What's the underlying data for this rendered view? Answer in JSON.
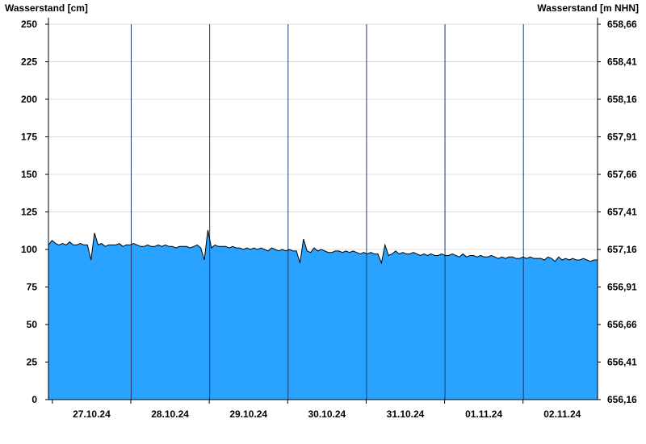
{
  "chart_data": {
    "type": "area",
    "ylabel_left": "Wasserstand [cm]",
    "ylabel_right": "Wasserstand [m NHN]",
    "ylim": [
      0,
      255
    ],
    "yticks_left": [
      "0",
      "25",
      "50",
      "75",
      "100",
      "125",
      "150",
      "175",
      "200",
      "225",
      "250"
    ],
    "yticks_right": [
      "656,16",
      "656,41",
      "656,66",
      "656,91",
      "657,16",
      "657,41",
      "657,66",
      "657,91",
      "658,16",
      "658,41",
      "658,66"
    ],
    "x_labels": [
      "27.10.24",
      "28.10.24",
      "29.10.24",
      "30.10.24",
      "31.10.24",
      "01.11.24",
      "02.11.24"
    ],
    "grid": true,
    "fill_color": "#29a3ff",
    "line_color": "#000000",
    "series": [
      {
        "values": [
          103,
          106,
          104,
          103,
          104,
          103,
          105,
          103,
          103,
          104,
          103,
          103,
          93,
          111,
          103,
          104,
          102,
          103,
          103,
          103,
          104,
          102,
          103,
          103,
          104,
          103,
          102,
          102,
          103,
          102,
          102,
          103,
          102,
          103,
          102,
          102,
          101,
          102,
          102,
          102,
          101,
          102,
          103,
          101,
          93,
          113,
          101,
          103,
          102,
          102,
          102,
          101,
          102,
          101,
          101,
          100,
          101,
          100,
          101,
          100,
          101,
          100,
          99,
          101,
          100,
          99,
          100,
          99,
          100,
          99,
          99,
          91,
          107,
          99,
          98,
          101,
          99,
          100,
          99,
          98,
          98,
          99,
          99,
          98,
          99,
          98,
          99,
          98,
          97,
          98,
          97,
          98,
          97,
          97,
          91,
          103,
          96,
          97,
          99,
          97,
          98,
          97,
          97,
          98,
          97,
          96,
          97,
          96,
          97,
          96,
          96,
          97,
          96,
          96,
          97,
          96,
          95,
          97,
          95,
          96,
          96,
          95,
          96,
          95,
          95,
          96,
          95,
          94,
          95,
          94,
          95,
          95,
          94,
          94,
          95,
          94,
          95,
          94,
          94,
          94,
          93,
          95,
          94,
          92,
          95,
          93,
          94,
          93,
          94,
          93,
          93,
          94,
          93,
          92,
          93,
          93
        ]
      }
    ]
  }
}
